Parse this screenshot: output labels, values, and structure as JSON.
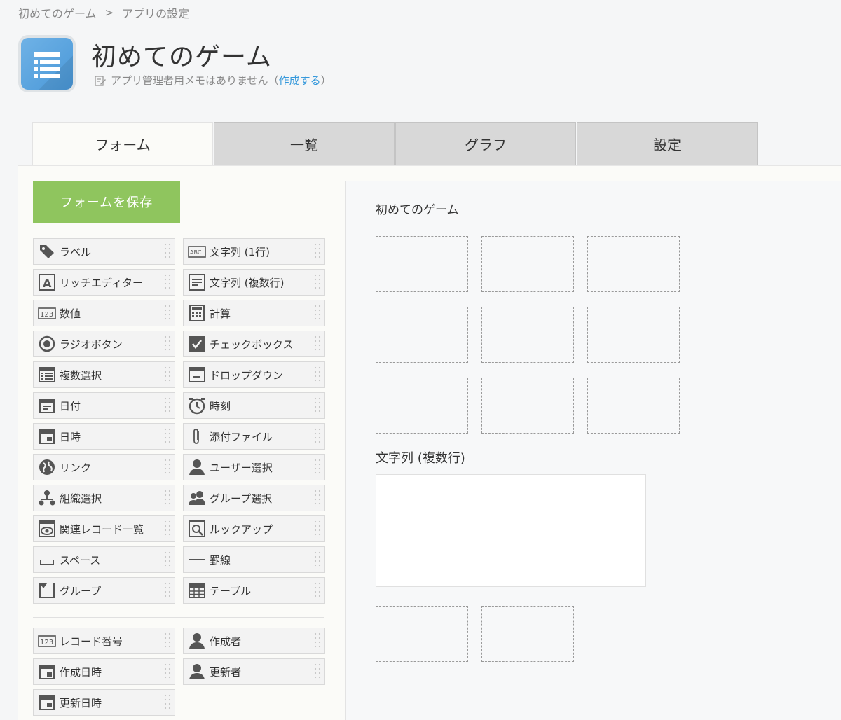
{
  "breadcrumb": {
    "items": [
      "初めてのゲーム",
      "アプリの設定"
    ],
    "separator": ">"
  },
  "app": {
    "title": "初めてのゲーム",
    "memo_text": "アプリ管理者用メモはありません（",
    "memo_link": "作成する",
    "memo_close": "）"
  },
  "tabs": [
    {
      "label": "フォーム",
      "active": true
    },
    {
      "label": "一覧",
      "active": false
    },
    {
      "label": "グラフ",
      "active": false
    },
    {
      "label": "設定",
      "active": false
    }
  ],
  "save_button": "フォームを保存",
  "palette": {
    "left": [
      {
        "label": "ラベル",
        "icon": "tag-icon"
      },
      {
        "label": "リッチエディター",
        "icon": "rich-editor-icon"
      },
      {
        "label": "数値",
        "icon": "number-icon"
      },
      {
        "label": "ラジオボタン",
        "icon": "radio-icon"
      },
      {
        "label": "複数選択",
        "icon": "multi-select-icon"
      },
      {
        "label": "日付",
        "icon": "date-icon"
      },
      {
        "label": "日時",
        "icon": "datetime-icon"
      },
      {
        "label": "リンク",
        "icon": "globe-icon"
      },
      {
        "label": "組織選択",
        "icon": "org-icon"
      },
      {
        "label": "関連レコード一覧",
        "icon": "related-records-icon"
      },
      {
        "label": "スペース",
        "icon": "space-icon"
      },
      {
        "label": "グループ",
        "icon": "group-icon"
      }
    ],
    "right": [
      {
        "label": "文字列 (1行)",
        "icon": "text-single-icon"
      },
      {
        "label": "文字列 (複数行)",
        "icon": "text-multi-icon"
      },
      {
        "label": "計算",
        "icon": "calculator-icon"
      },
      {
        "label": "チェックボックス",
        "icon": "checkbox-icon"
      },
      {
        "label": "ドロップダウン",
        "icon": "dropdown-icon"
      },
      {
        "label": "時刻",
        "icon": "clock-icon"
      },
      {
        "label": "添付ファイル",
        "icon": "paperclip-icon"
      },
      {
        "label": "ユーザー選択",
        "icon": "user-icon"
      },
      {
        "label": "グループ選択",
        "icon": "users-icon"
      },
      {
        "label": "ルックアップ",
        "icon": "lookup-icon"
      },
      {
        "label": "罫線",
        "icon": "line-icon"
      },
      {
        "label": "テーブル",
        "icon": "table-icon"
      }
    ],
    "system_left": [
      {
        "label": "レコード番号",
        "icon": "record-number-icon"
      },
      {
        "label": "作成日時",
        "icon": "created-date-icon"
      },
      {
        "label": "更新日時",
        "icon": "updated-date-icon"
      }
    ],
    "system_right": [
      {
        "label": "作成者",
        "icon": "creator-icon"
      },
      {
        "label": "更新者",
        "icon": "updater-icon"
      }
    ]
  },
  "canvas": {
    "title": "初めてのゲーム",
    "field_label": "文字列 (複数行)"
  },
  "colors": {
    "save": "#8fc55e",
    "link": "#3498db",
    "app_icon": "#5aa5e0"
  }
}
